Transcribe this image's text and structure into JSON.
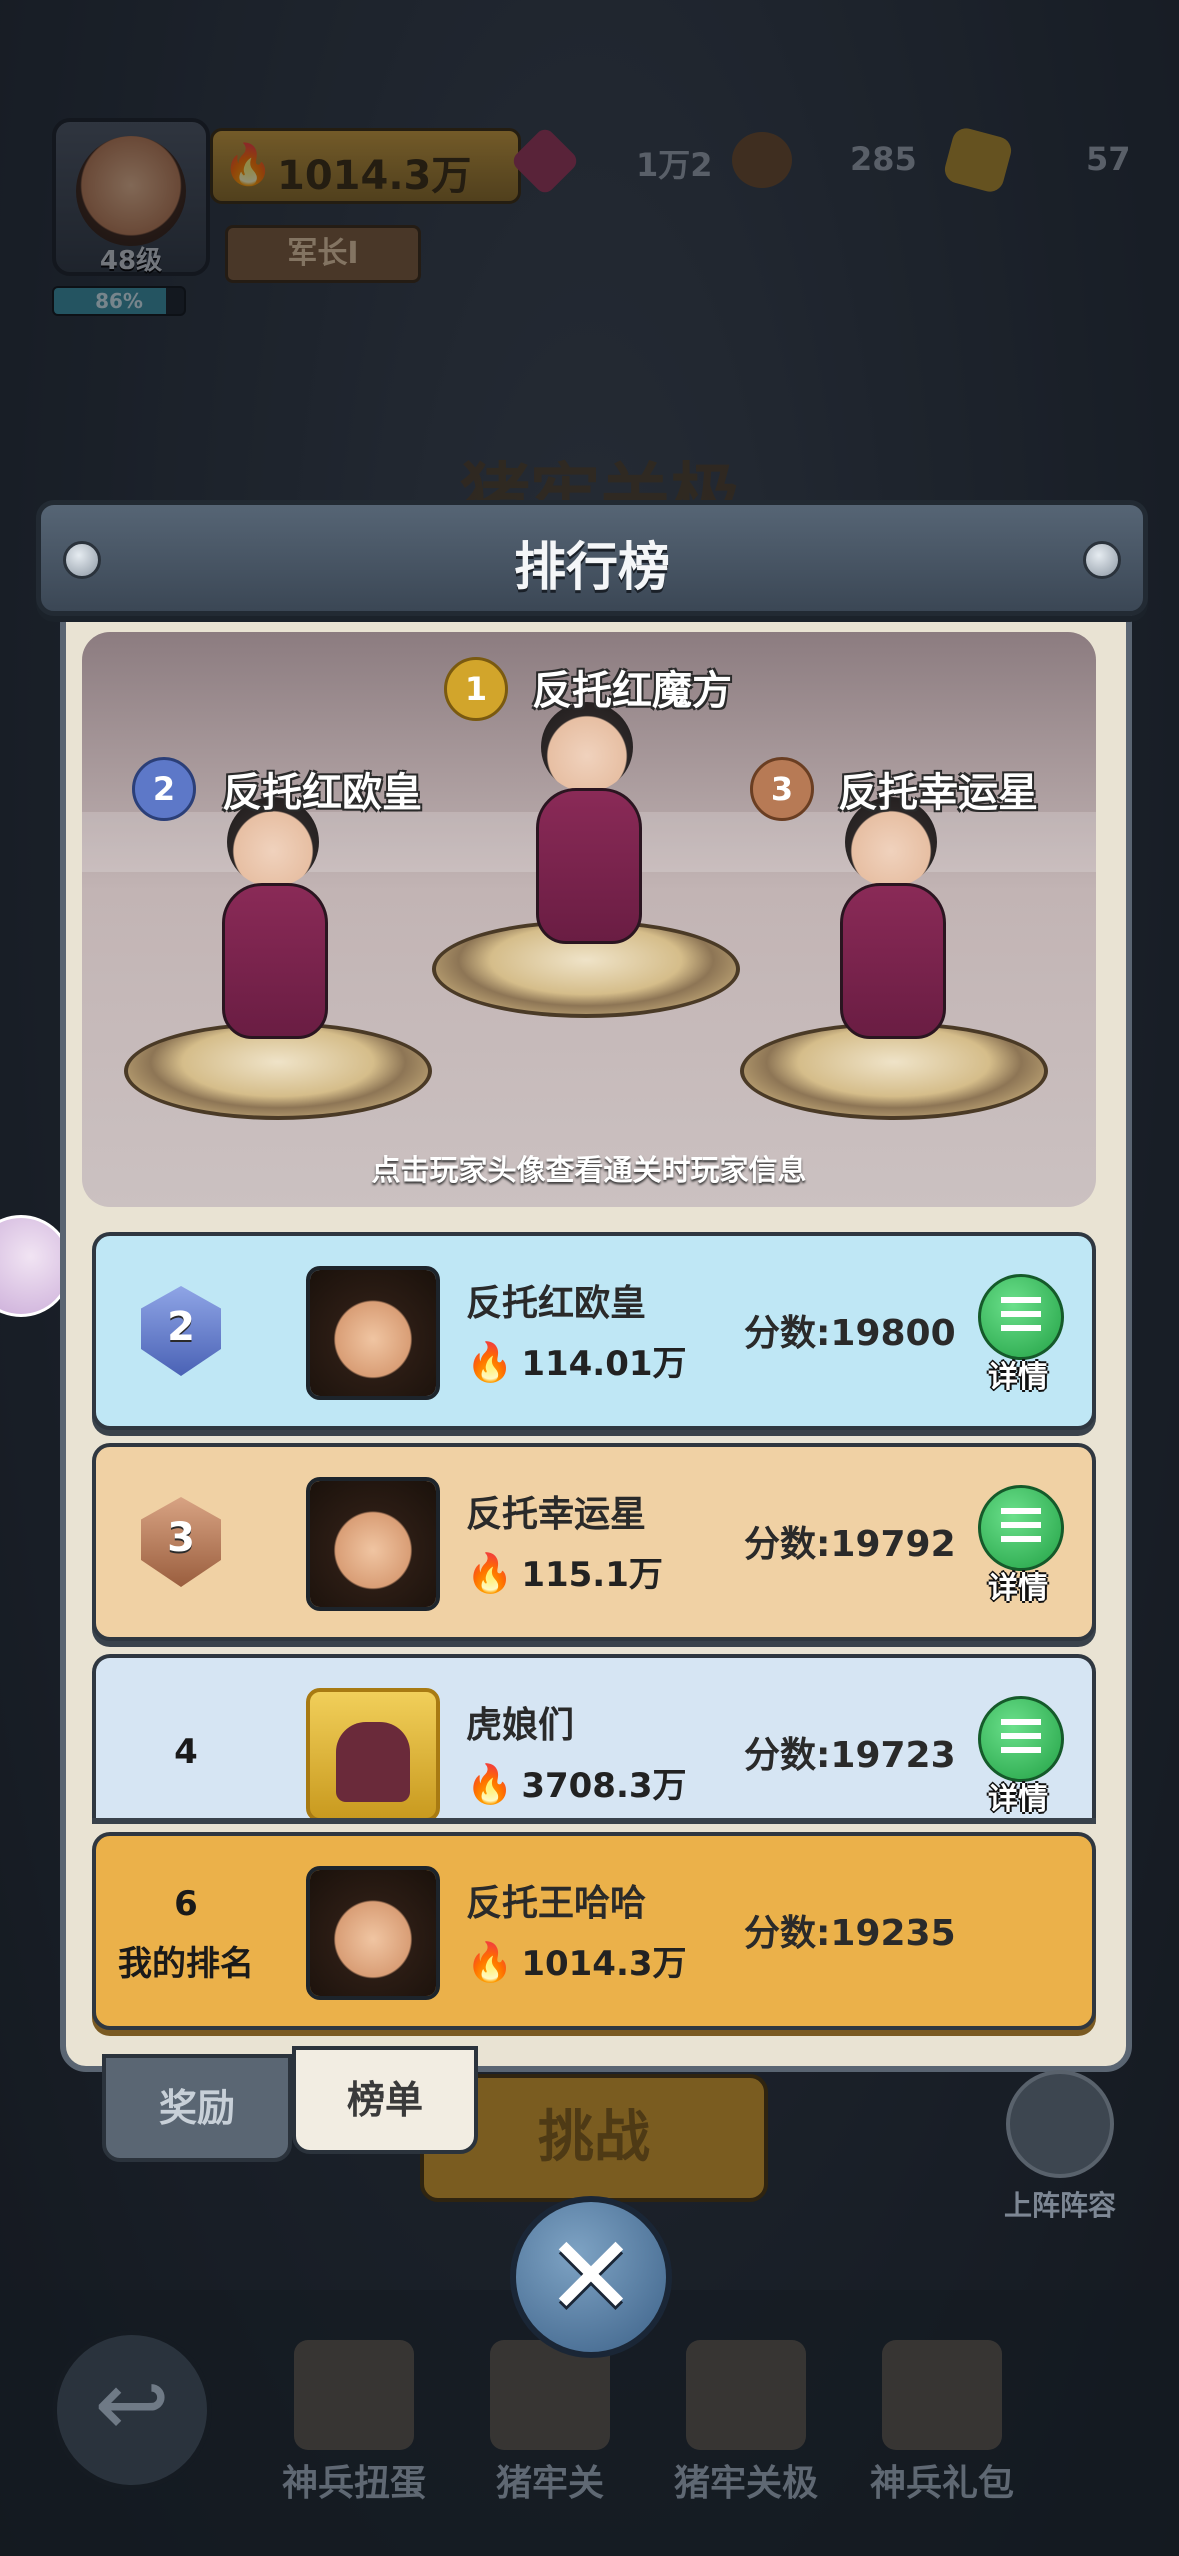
{
  "hud": {
    "level": "48级",
    "exp_percent": "86%",
    "exp_fraction": 0.86,
    "power": "1014.3万",
    "rank_title": "军长I",
    "gems": "1万2",
    "resource_2": "285",
    "resource_3": "57"
  },
  "background_title": "猪牢关极",
  "modal": {
    "title": "排行榜",
    "podium": {
      "first": {
        "rank": "1",
        "name": "反托红魔方"
      },
      "second": {
        "rank": "2",
        "name": "反托红欧皇"
      },
      "third": {
        "rank": "3",
        "name": "反托幸运星"
      },
      "hint": "点击玩家头像查看通关时玩家信息"
    },
    "score_label": "分数:",
    "detail_label": "详情",
    "rows": [
      {
        "rank": "2",
        "name": "反托红欧皇",
        "power": "114.01万",
        "score": "19800"
      },
      {
        "rank": "3",
        "name": "反托幸运星",
        "power": "115.1万",
        "score": "19792"
      },
      {
        "rank": "4",
        "name": "虎娘们",
        "power": "3708.3万",
        "score": "19723"
      }
    ],
    "my_rank": {
      "rank": "6",
      "label": "我的排名",
      "name": "反托王哈哈",
      "power": "1014.3万",
      "score": "19235"
    }
  },
  "tabs": {
    "reward": "奖励",
    "board": "榜单"
  },
  "challenge_label": "挑战",
  "lineup_label": "上阵阵容",
  "close_label": "✕",
  "bottom_nav": [
    {
      "label": "神兵扭蛋"
    },
    {
      "label": "猪牢关"
    },
    {
      "label": "猪牢关极"
    },
    {
      "label": "神兵礼包"
    }
  ],
  "colors": {
    "accent_gold": "#ebb14a",
    "row_blue": "#bfe7f5",
    "row_orange": "#f0d1a4",
    "detail_green": "#22a145"
  }
}
